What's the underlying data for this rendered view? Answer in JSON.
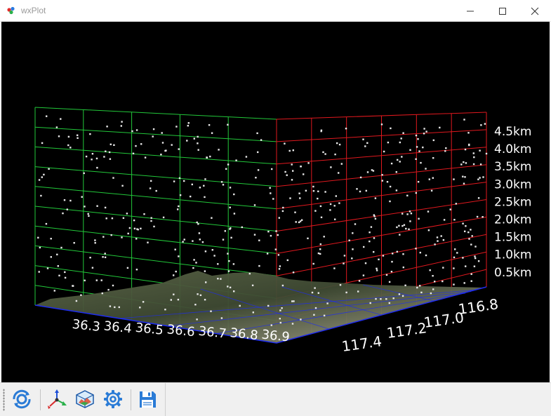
{
  "window": {
    "title": "wxPlot"
  },
  "colors": {
    "left_wall": "#22c83a",
    "right_wall": "#e0181e",
    "floor_grid": "#1e2cf0",
    "points": "#e8e8e8",
    "labels": "#ffffff"
  },
  "plot": {
    "z_axis_labels": [
      "4.5km",
      "4.0km",
      "3.5km",
      "3.0km",
      "2.5km",
      "2.0km",
      "1.5km",
      "1.0km",
      "0.5km"
    ],
    "x_axis_labels": [
      "36.3",
      "36.4",
      "36.5",
      "36.6",
      "36.7",
      "36.8",
      "36.9"
    ],
    "y_axis_labels": [
      "116.8",
      "117.0",
      "117.2",
      "117.4"
    ]
  },
  "toolbar": {
    "buttons": [
      {
        "name": "rotate-view-button",
        "icon": "rotate-icon"
      },
      {
        "name": "axes-button",
        "icon": "axes-icon"
      },
      {
        "name": "bounding-box-button",
        "icon": "cube-icon"
      },
      {
        "name": "settings-button",
        "icon": "gear-icon"
      },
      {
        "name": "save-button",
        "icon": "save-icon"
      }
    ]
  }
}
